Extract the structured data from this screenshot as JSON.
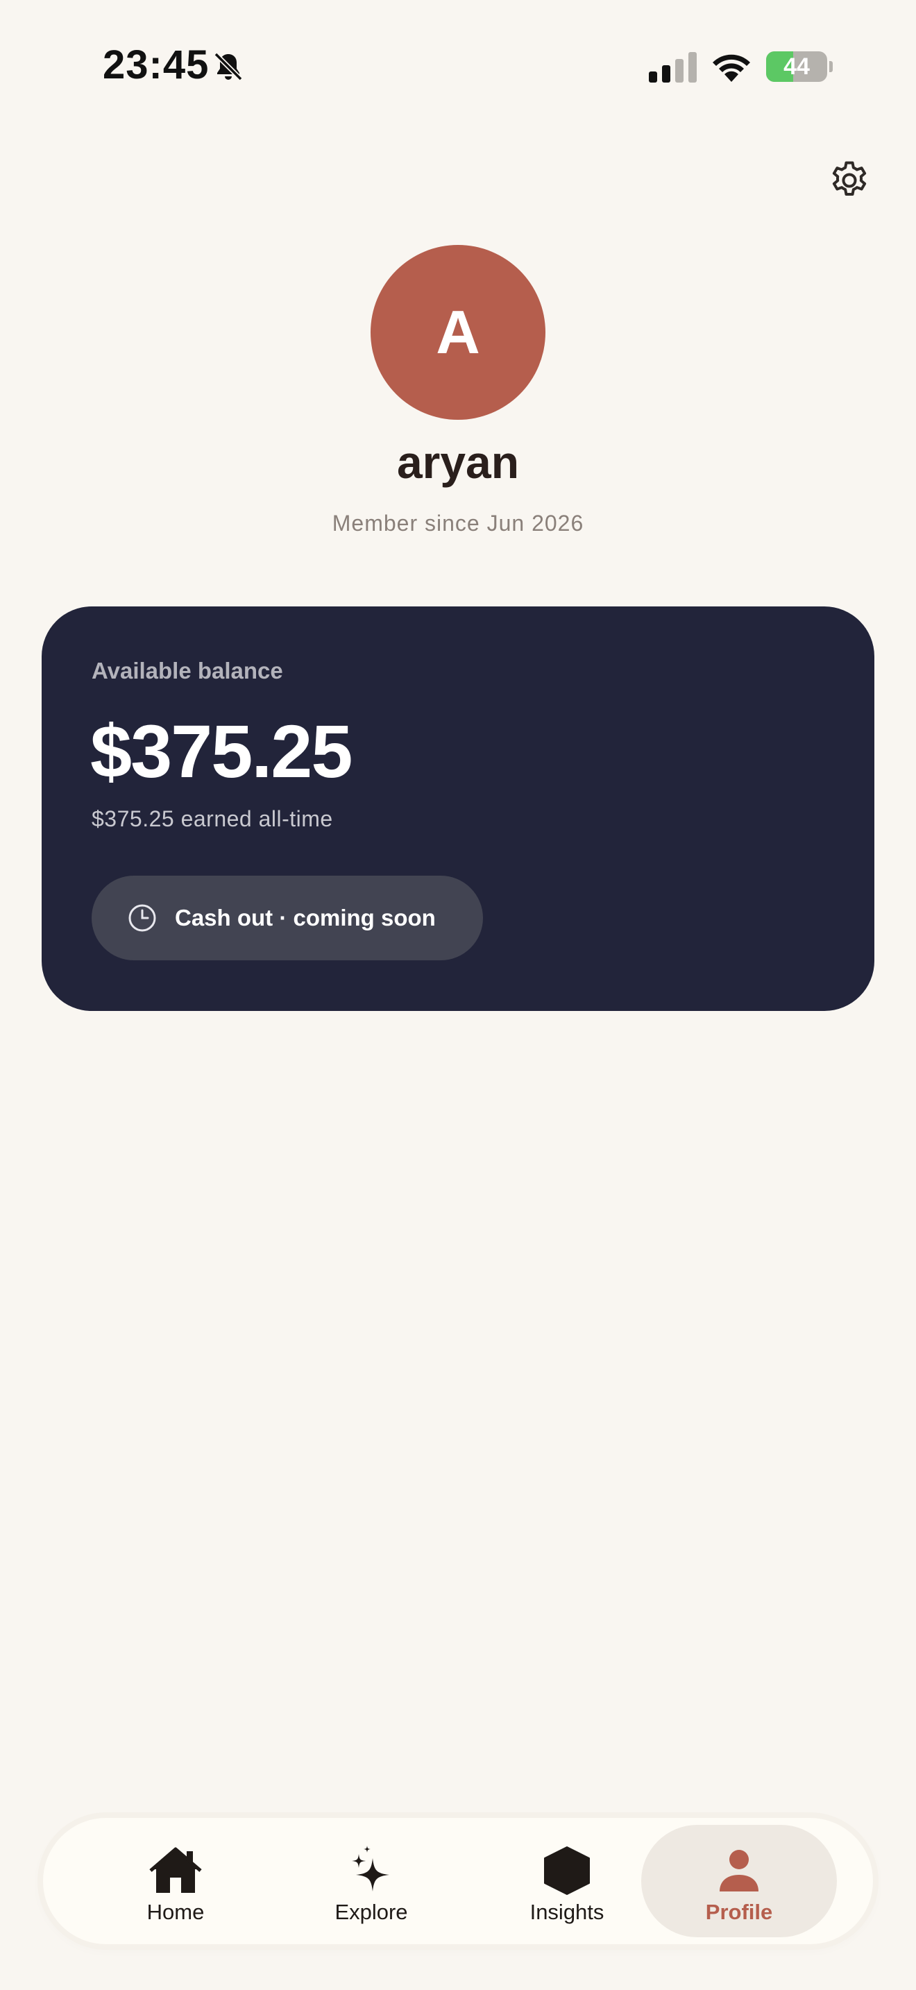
{
  "status_bar": {
    "time": "23:45",
    "battery_percent": "44",
    "battery_level": 0.44,
    "icons": [
      "bell-muted-icon",
      "cellular-signal-icon",
      "wifi-icon",
      "battery-charging-icon"
    ]
  },
  "header": {
    "settings_icon": "gear-icon"
  },
  "profile": {
    "avatar_initial": "A",
    "avatar_color": "#b55e4d",
    "name": "aryan",
    "member_since": "Member since Jun 2026"
  },
  "balance_card": {
    "label": "Available balance",
    "amount": "$375.25",
    "earned": "$375.25 earned all-time",
    "cashout_label": "Cash out · coming soon",
    "cashout_icon": "clock-icon",
    "background_color": "#22243a"
  },
  "tab_bar": {
    "active_color": "#b55e4d",
    "tabs": [
      {
        "label": "Home",
        "icon": "home-icon"
      },
      {
        "label": "Explore",
        "icon": "sparkle-icon"
      },
      {
        "label": "Insights",
        "icon": "hexagon-icon"
      },
      {
        "label": "Profile",
        "icon": "person-icon",
        "active": true
      }
    ]
  }
}
